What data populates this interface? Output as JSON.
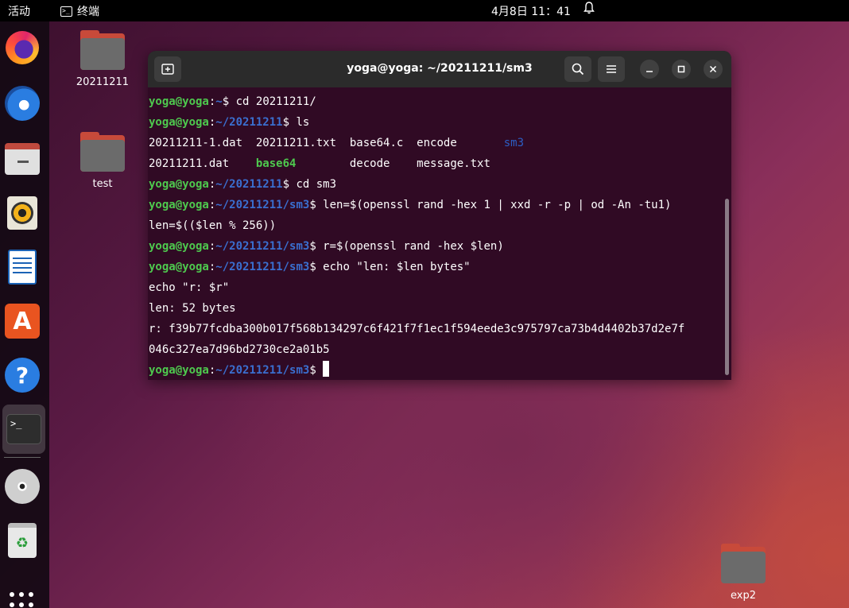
{
  "topbar": {
    "activities": "活动",
    "app_name": "终端",
    "app_icon_glyph": ">_",
    "clock": "4月8日  11：41"
  },
  "dock": {
    "items": [
      "firefox-icon",
      "thunderbird-icon",
      "files-icon",
      "rhythmbox-icon",
      "libreoffice-writer-icon",
      "software-icon",
      "help-icon",
      "terminal-icon",
      "disc-icon",
      "trash-icon",
      "show-apps-icon"
    ],
    "help_glyph": "?",
    "software_glyph": "A",
    "terminal_glyph": ">_",
    "trash_glyph": "♻"
  },
  "desktop": {
    "icons": [
      {
        "label": "20211211"
      },
      {
        "label": "test"
      },
      {
        "label": "exp2"
      }
    ]
  },
  "terminal": {
    "title": "yoga@yoga: ~/20211211/sm3",
    "prompt_user": "yoga@yoga",
    "lines": [
      {
        "path": "~",
        "cmd": " cd 20211211/"
      },
      {
        "path": "~/20211211",
        "cmd": " ls"
      },
      {
        "ls1": [
          "20211211-1.dat  ",
          "20211211.txt  ",
          "base64.c  ",
          "encode       ",
          "sm3"
        ]
      },
      {
        "ls2": [
          "20211211.dat    ",
          "base64",
          "        ",
          "decode    ",
          "message.txt"
        ]
      },
      {
        "path": "~/20211211",
        "cmd": " cd sm3"
      },
      {
        "path": "~/20211211/sm3",
        "cmd": " len=$(openssl rand -hex 1 | xxd -r -p | od -An -tu1)"
      },
      {
        "text": "len=$(($len % 256))"
      },
      {
        "path": "~/20211211/sm3",
        "cmd": " r=$(openssl rand -hex $len)"
      },
      {
        "path": "~/20211211/sm3",
        "cmd": " echo \"len: $len bytes\""
      },
      {
        "text": "echo \"r: $r\""
      },
      {
        "text": "len: 52 bytes"
      },
      {
        "text": "r: f39b77fcdba300b017f568b134297c6f421f7f1ec1f594eede3c975797ca73b4d4402b37d2e7f"
      },
      {
        "text": "046c327ea7d96bd2730ce2a01b5"
      },
      {
        "path": "~/20211211/sm3",
        "cmd": " "
      }
    ],
    "colors": {
      "background": "#300a24",
      "prompt_user": "#4ec94e",
      "prompt_path": "#3a6fd0",
      "directory": "#2c5ec4",
      "executable": "#4ec94e"
    }
  }
}
